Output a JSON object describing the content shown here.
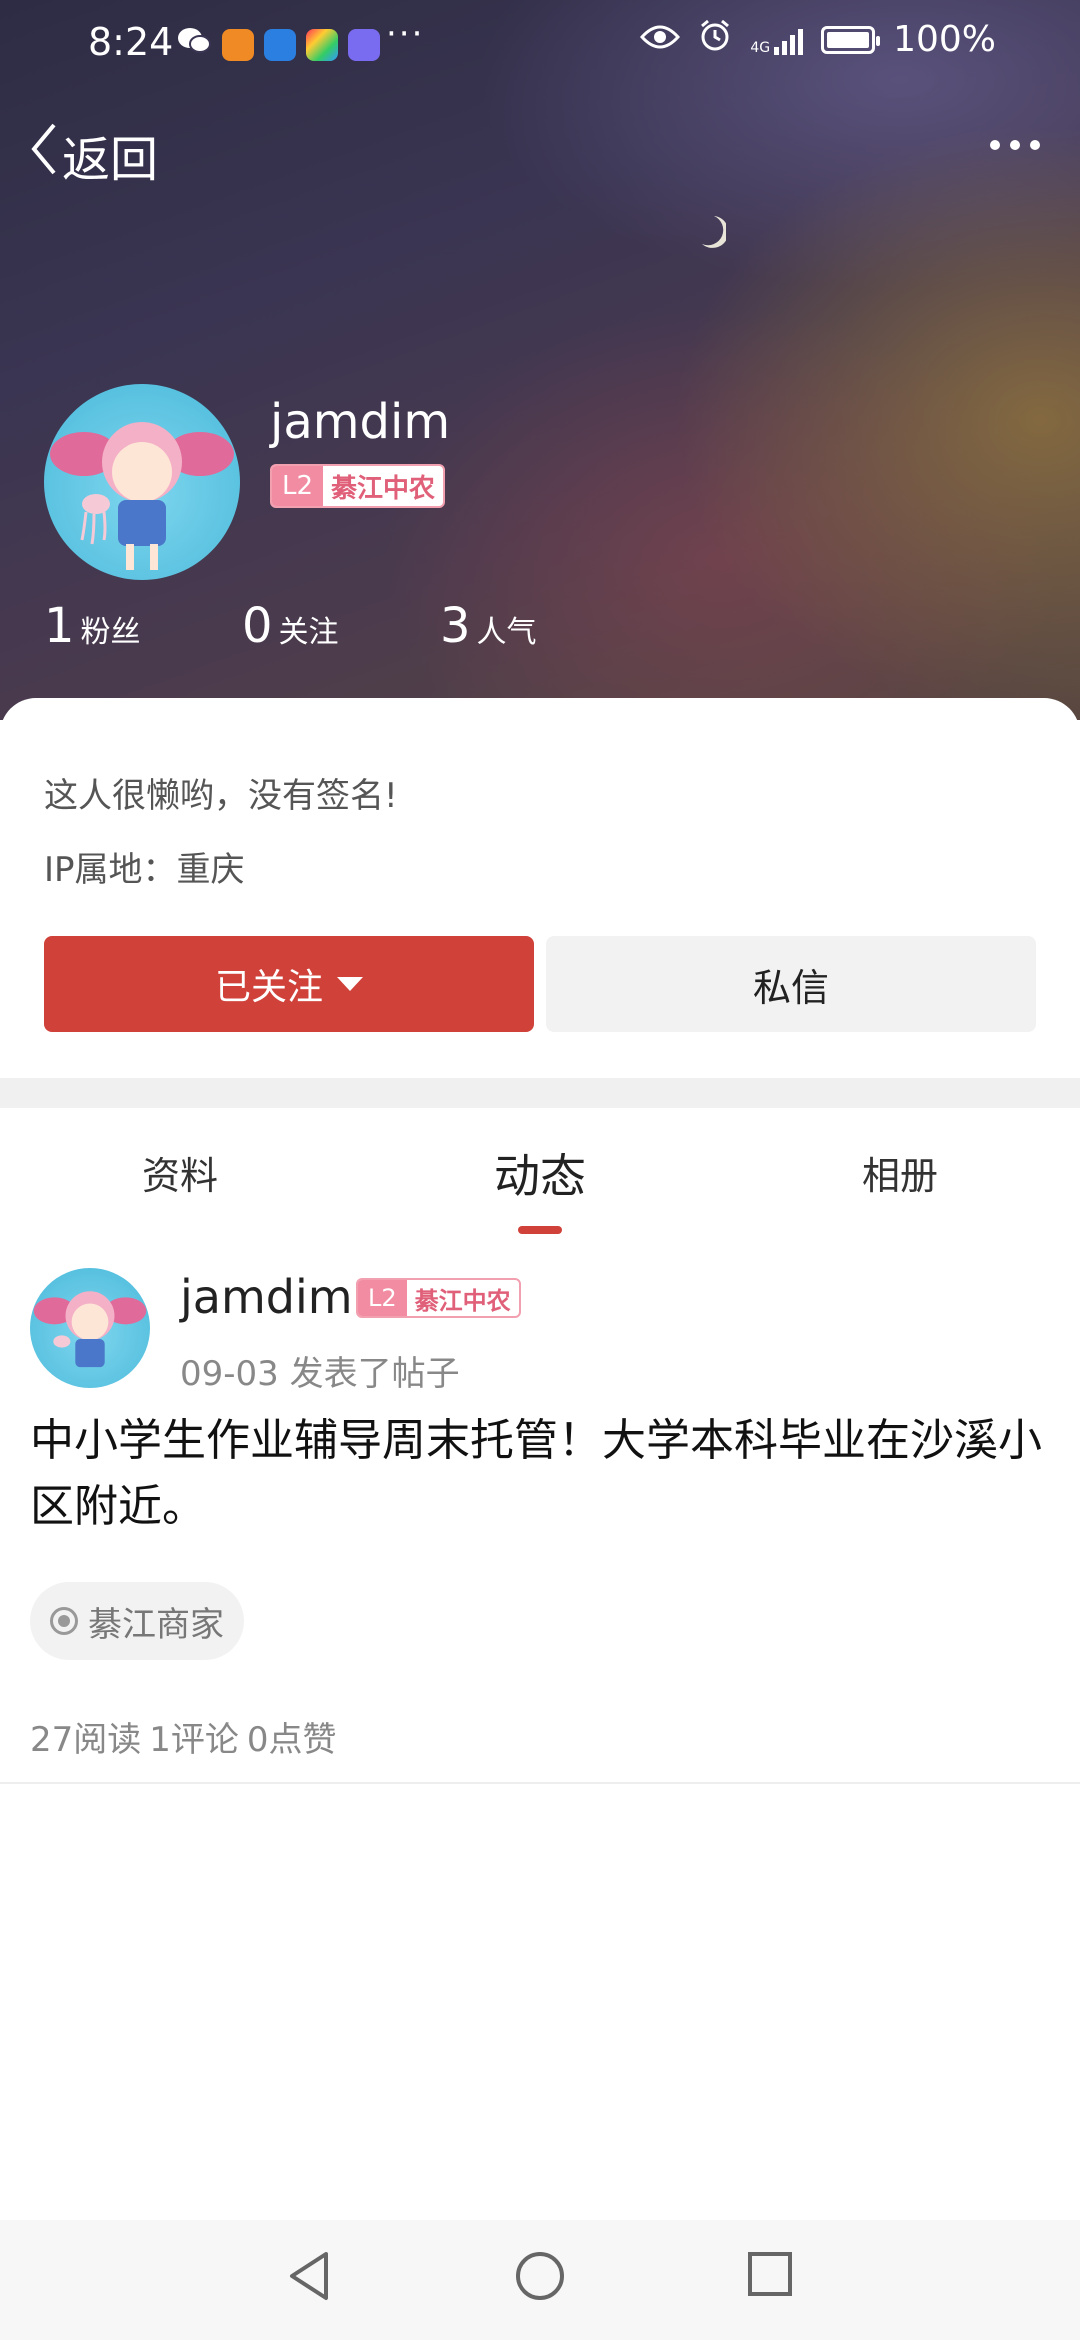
{
  "status_bar": {
    "time": "8:24",
    "more": "···",
    "battery_percent": "100%",
    "network": "4G"
  },
  "header": {
    "back_label": "返回",
    "more_icon": "more-dots-icon"
  },
  "profile": {
    "username": "jamdim",
    "level": "L2",
    "badge_name": "綦江中农",
    "stats": [
      {
        "value": "1",
        "label": "粉丝"
      },
      {
        "value": "0",
        "label": "关注"
      },
      {
        "value": "3",
        "label": "人气"
      }
    ],
    "signature": "这人很懒哟，没有签名!",
    "ip_location": "IP属地：重庆",
    "follow_button": "已关注",
    "message_button": "私信",
    "accent_color": "#d0413a"
  },
  "tabs": [
    {
      "label": "资料",
      "active": false
    },
    {
      "label": "动态",
      "active": true
    },
    {
      "label": "相册",
      "active": false
    }
  ],
  "post": {
    "author": "jamdim",
    "level": "L2",
    "badge_name": "綦江中农",
    "meta": "09-03 发表了帖子",
    "text": "中小学生作业辅导周末托管！大学本科毕业在沙溪小区附近。",
    "tag": "綦江商家",
    "reads": "27阅读",
    "comments": "1评论",
    "likes": "0点赞"
  }
}
